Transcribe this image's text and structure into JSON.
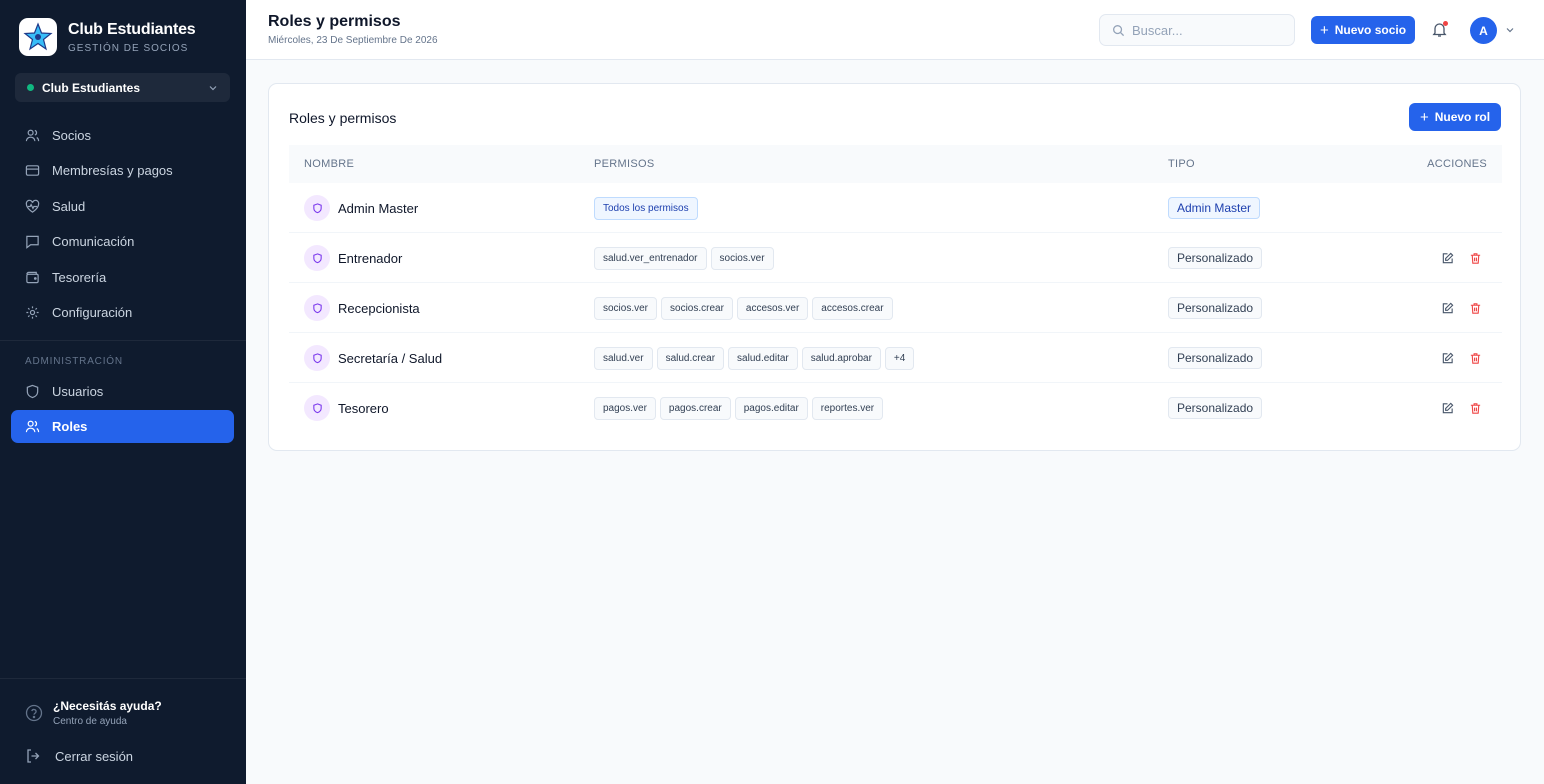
{
  "sidebar": {
    "brand_title": "Club Estudiantes",
    "brand_subtitle": "GESTIÓN DE SOCIOS",
    "club_selector": "Club Estudiantes",
    "nav": [
      {
        "label": "Socios",
        "icon": "users-icon"
      },
      {
        "label": "Membresías y pagos",
        "icon": "credit-card-icon"
      },
      {
        "label": "Salud",
        "icon": "heart-pulse-icon"
      },
      {
        "label": "Comunicación",
        "icon": "message-icon"
      },
      {
        "label": "Tesorería",
        "icon": "wallet-icon"
      },
      {
        "label": "Configuración",
        "icon": "gear-icon"
      }
    ],
    "admin_section": "ADMINISTRACIÓN",
    "admin_nav": [
      {
        "label": "Usuarios",
        "icon": "shield-icon"
      },
      {
        "label": "Roles",
        "icon": "users-icon",
        "active": true
      }
    ],
    "help_title": "¿Necesitás ayuda?",
    "help_subtitle": "Centro de ayuda",
    "logout": "Cerrar sesión"
  },
  "header": {
    "title": "Roles y permisos",
    "date": "Miércoles, 23 De Septiembre De 2026",
    "search_placeholder": "Buscar...",
    "new_member_button": "Nuevo socio",
    "avatar_initial": "A"
  },
  "card": {
    "title": "Roles y permisos",
    "new_role_button": "Nuevo rol",
    "columns": [
      "NOMBRE",
      "PERMISOS",
      "TIPO",
      "ACCIONES"
    ],
    "rows": [
      {
        "name": "Admin Master",
        "permissions": [
          "Todos los permisos"
        ],
        "type": "Admin Master",
        "editable": false
      },
      {
        "name": "Entrenador",
        "permissions": [
          "salud.ver_entrenador",
          "socios.ver"
        ],
        "type": "Personalizado",
        "editable": true
      },
      {
        "name": "Recepcionista",
        "permissions": [
          "socios.ver",
          "socios.crear",
          "accesos.ver",
          "accesos.crear"
        ],
        "type": "Personalizado",
        "editable": true
      },
      {
        "name": "Secretaría / Salud",
        "permissions": [
          "salud.ver",
          "salud.crear",
          "salud.editar",
          "salud.aprobar",
          "+4"
        ],
        "type": "Personalizado",
        "editable": true
      },
      {
        "name": "Tesorero",
        "permissions": [
          "pagos.ver",
          "pagos.crear",
          "pagos.editar",
          "reportes.ver"
        ],
        "type": "Personalizado",
        "editable": true
      }
    ]
  },
  "colors": {
    "sidebar_bg": "#0f1b2e",
    "accent": "#2563eb",
    "danger": "#ef4444",
    "status_green": "#10b981"
  }
}
